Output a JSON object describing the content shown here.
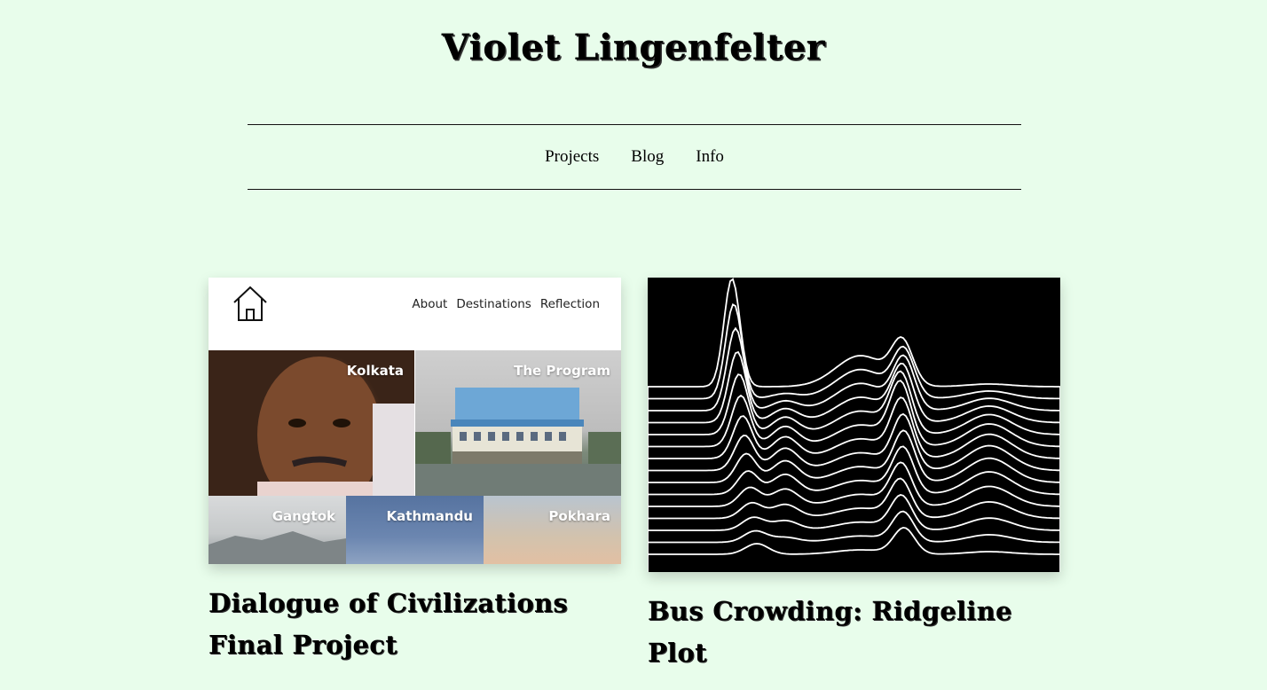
{
  "site": {
    "title": "Violet Lingenfelter"
  },
  "nav": {
    "items": [
      "Projects",
      "Blog",
      "Info"
    ]
  },
  "projects": [
    {
      "title": "Dialogue of Civilizations Final Project",
      "thumbnail": {
        "mini_nav": [
          "About",
          "Destinations",
          "Reflection"
        ],
        "tiles": [
          "Kolkata",
          "The Program",
          "Gangtok",
          "Kathmandu",
          "Pokhara"
        ]
      }
    },
    {
      "title": "Bus Crowding: Ridgeline Plot"
    }
  ],
  "colors": {
    "background": "#e8fdeb",
    "text": "#000000"
  }
}
